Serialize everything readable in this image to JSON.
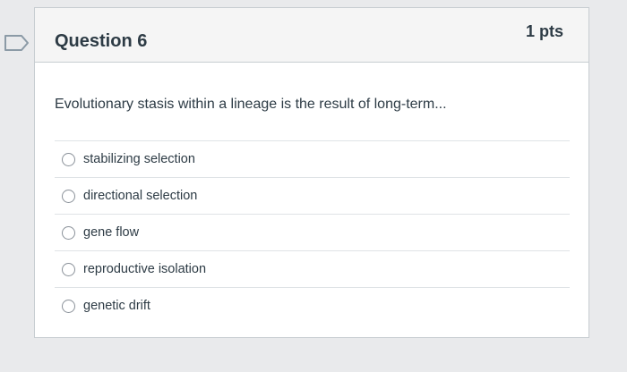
{
  "question": {
    "title": "Question 6",
    "points": "1 pts",
    "text": "Evolutionary stasis within a lineage is the result of long-term...",
    "flag_icon": "flag-icon"
  },
  "answers": [
    {
      "label": "stabilizing selection",
      "selected": false
    },
    {
      "label": "directional selection",
      "selected": false
    },
    {
      "label": "gene flow",
      "selected": false
    },
    {
      "label": "reproductive isolation",
      "selected": false
    },
    {
      "label": "genetic drift",
      "selected": false
    }
  ]
}
